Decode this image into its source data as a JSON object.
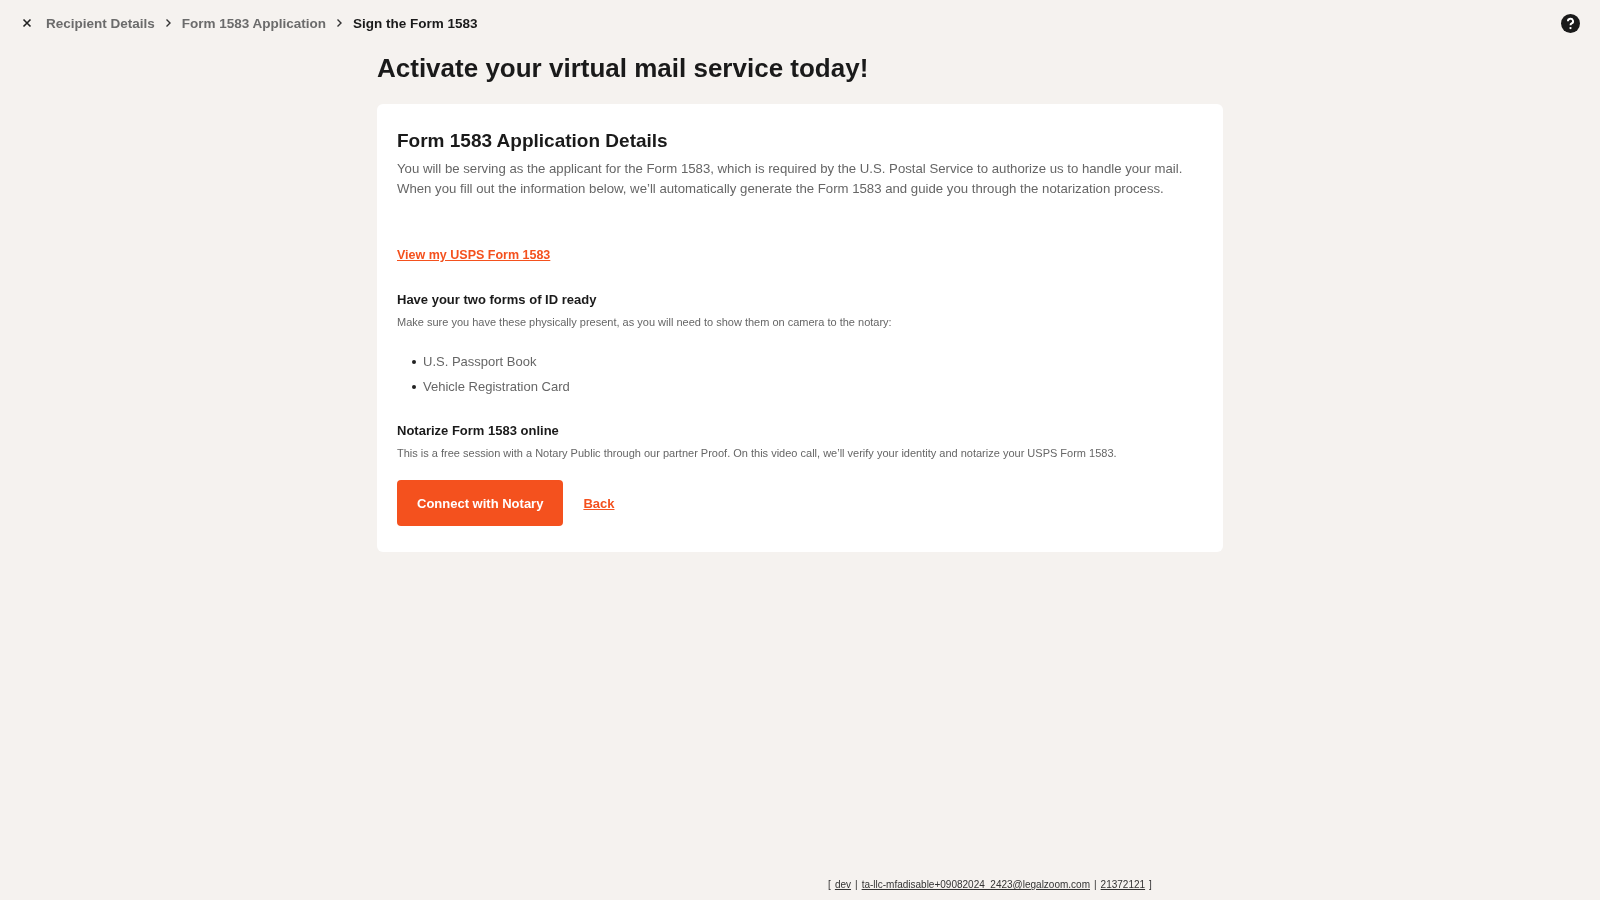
{
  "breadcrumbs": [
    {
      "label": "Recipient Details",
      "selected": false
    },
    {
      "label": "Form 1583 Application",
      "selected": false
    },
    {
      "label": "Sign the Form 1583",
      "selected": true
    }
  ],
  "page_title": "Activate your virtual mail service today!",
  "card": {
    "title": "Form 1583 Application Details",
    "intro": "You will be serving as the applicant for the Form 1583, which is required by the U.S. Postal Service to authorize us to handle your mail. When you fill out the information below, we’ll automatically generate the Form 1583 and guide you through the notarization process.",
    "link": "View my USPS Form 1583",
    "id_heading": "Have your two forms of ID ready",
    "id_note": "Make sure you have these physically present, as you will need to show them on camera to the notary:",
    "id_items": [
      "U.S. Passport Book",
      "Vehicle Registration Card"
    ],
    "notary_heading": "Notarize Form 1583 online",
    "notary_note": "This is a free session with a Notary Public through our partner Proof. On this video call, we’ll verify your identity and notarize your USPS Form 1583.",
    "primary_button": "Connect with Notary",
    "back_link": "Back"
  },
  "footer": {
    "open": "[",
    "env": "dev",
    "sep1": "|",
    "email": "ta-llc-mfadisable+09082024_2423@legalzoom.com",
    "sep2": "|",
    "id": "21372121",
    "close": "]"
  }
}
